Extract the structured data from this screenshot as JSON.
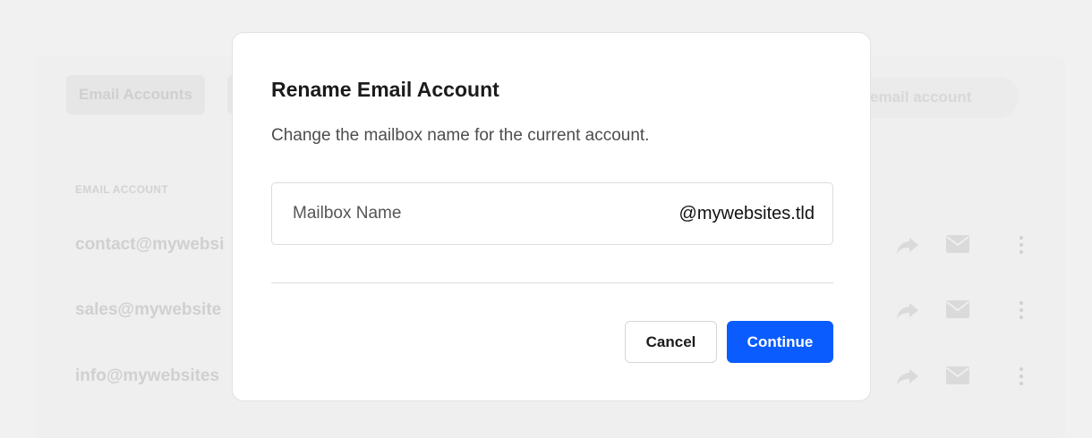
{
  "background": {
    "tabs": [
      "Email Accounts"
    ],
    "add_button_label": "email account",
    "column_header": "EMAIL ACCOUNT",
    "rows": [
      {
        "email": "contact@mywebsi"
      },
      {
        "email": "sales@mywebsite"
      },
      {
        "email": "info@mywebsites"
      }
    ]
  },
  "dialog": {
    "title": "Rename Email Account",
    "description": "Change the mailbox name for the current account.",
    "mailbox_field": {
      "placeholder": "Mailbox Name",
      "value": "",
      "suffix": "@mywebsites.tld"
    },
    "cancel_label": "Cancel",
    "continue_label": "Continue"
  },
  "colors": {
    "primary": "#0a5cff",
    "background": "#f1f1f1",
    "modal": "#ffffff"
  }
}
